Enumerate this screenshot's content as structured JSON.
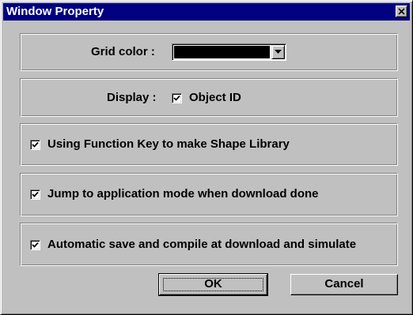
{
  "window": {
    "title": "Window Property"
  },
  "grid": {
    "label": "Grid  color :",
    "color": "#000000"
  },
  "display": {
    "label": "Display :",
    "object_id_label": "Object ID",
    "object_id_checked": true
  },
  "options": [
    {
      "label": "Using Function Key to make Shape Library",
      "checked": true
    },
    {
      "label": "Jump to application mode when download done",
      "checked": true
    },
    {
      "label": "Automatic save and compile at download and simulate",
      "checked": true
    }
  ],
  "buttons": {
    "ok_label": "OK",
    "cancel_label": "Cancel"
  },
  "colors": {
    "face": "#c0c0c0",
    "title_bar": "#000080"
  },
  "icons": {
    "close": "close-icon",
    "dropdown": "chevron-down-icon",
    "check": "checkmark-icon"
  }
}
